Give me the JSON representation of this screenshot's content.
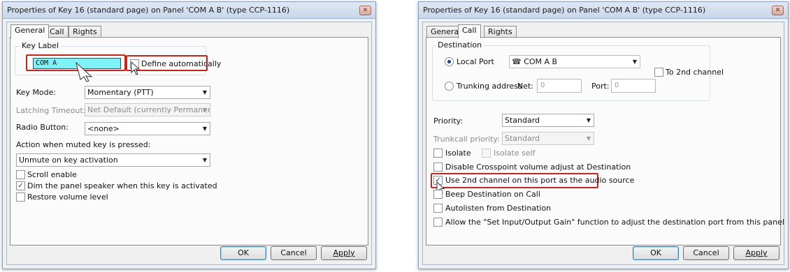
{
  "left_dialog": {
    "title": "Properties of Key 16 (standard page) on Panel 'COM A B' (type CCP-1116)",
    "tabs": [
      "General",
      "Call",
      "Rights"
    ],
    "active_tab": "General",
    "key_label_group": "Key Label",
    "key_label_value": "COM A",
    "define_automatically": "Define automatically",
    "key_mode_label": "Key Mode:",
    "key_mode_value": "Momentary (PTT)",
    "latching_timeout_label": "Latching Timeout:",
    "latching_timeout_value": "Net Default (currently Permanent)",
    "radio_button_label": "Radio Button:",
    "radio_button_value": "<none>",
    "action_muted_label": "Action when muted key is pressed:",
    "action_muted_value": "Unmute on key activation",
    "checkboxes": [
      {
        "label": "Scroll enable",
        "checked": false
      },
      {
        "label": "Dim the panel speaker when this key is activated",
        "checked": true
      },
      {
        "label": "Restore volume level",
        "checked": false
      }
    ],
    "buttons": {
      "ok": "OK",
      "cancel": "Cancel",
      "apply": "Apply"
    }
  },
  "right_dialog": {
    "title": "Properties of Key 16 (standard page) on Panel 'COM A B' (type CCP-1116)",
    "tabs": [
      "General",
      "Call",
      "Rights"
    ],
    "active_tab": "Call",
    "destination_group": "Destination",
    "local_port_label": "Local Port",
    "local_port_value": "COM A B",
    "to_2nd_channel": "To 2nd channel",
    "trunking_address_label": "Trunking address",
    "net_label": "Net:",
    "net_value": "0",
    "port_label": "Port:",
    "port_value": "0",
    "priority_label": "Priority:",
    "priority_value": "Standard",
    "trunkcall_priority_label": "Trunkcall priority:",
    "trunkcall_priority_value": "Standard",
    "isolate": "Isolate",
    "isolate_self": "Isolate self",
    "checkboxes": [
      {
        "label": "Disable Crosspoint volume adjust at Destination",
        "checked": false
      },
      {
        "label": "Use 2nd channel on this port as the audio source",
        "checked": true
      },
      {
        "label": "Beep Destination on Call",
        "checked": false
      },
      {
        "label": "Autolisten from Destination",
        "checked": false
      },
      {
        "label": "Allow the \"Set Input/Output Gain\" function to adjust the destination port from this panel",
        "checked": false
      }
    ],
    "buttons": {
      "ok": "OK",
      "cancel": "Cancel",
      "apply": "Apply"
    }
  },
  "colors": {
    "highlight_red": "#c0281e",
    "key_label_cyan": "#7ff2f8",
    "check_blue": "#1b3f86"
  }
}
